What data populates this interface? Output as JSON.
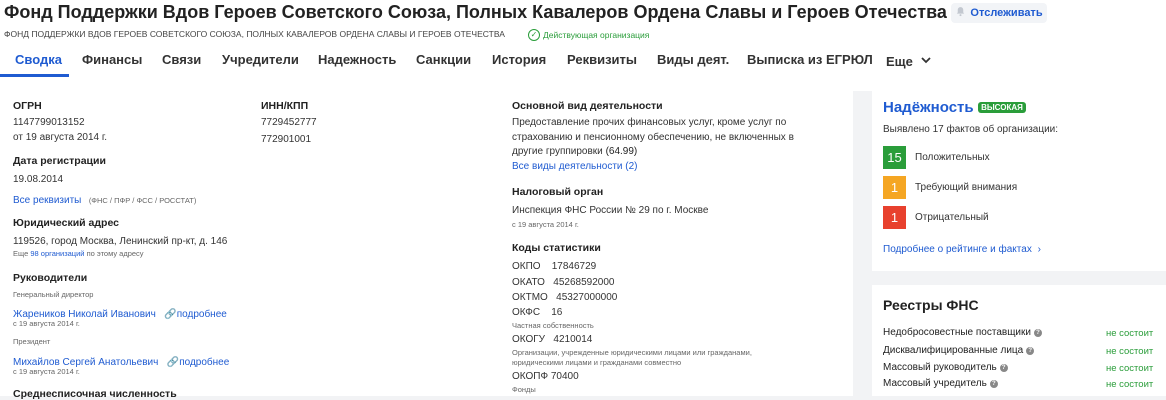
{
  "header": {
    "title": "Фонд Поддержки Вдов Героев Советского Союза, Полных Кавалеров Ордена Славы и Героев Отечества",
    "follow_label": "Отслеживать",
    "subtitle": "ФОНД ПОДДЕРЖКИ ВДОВ ГЕРОЕВ СОВЕТСКОГО СОЮЗА, ПОЛНЫХ КАВАЛЕРОВ ОРДЕНА СЛАВЫ И ГЕРОЕВ ОТЕЧЕСТВА",
    "status": "Действующая организация"
  },
  "tabs": [
    {
      "label": "Сводка"
    },
    {
      "label": "Финансы"
    },
    {
      "label": "Связи"
    },
    {
      "label": "Учредители"
    },
    {
      "label": "Надежность"
    },
    {
      "label": "Санкции"
    },
    {
      "label": "История"
    },
    {
      "label": "Реквизиты"
    },
    {
      "label": "Виды деят."
    },
    {
      "label": "Выписка из ЕГРЮЛ"
    },
    {
      "label": "Еще"
    }
  ],
  "summary": {
    "ogrn": {
      "label": "ОГРН",
      "value": "1147799013152",
      "date": "от 19 августа 2014 г."
    },
    "inn": {
      "label": "ИНН/КПП",
      "inn": "7729452777",
      "kpp": "772901001"
    },
    "reg_date": {
      "label": "Дата регистрации",
      "value": "19.08.2014"
    },
    "all_requisites": {
      "label": "Все реквизиты",
      "note": "(ФНС / ПФР / ФСС / РОССТАТ)"
    },
    "address": {
      "label": "Юридический адрес",
      "value": "119526, город Москва, Ленинский пр-кт, д. 146",
      "note_prefix": "Еще",
      "note_link": "98 организаций",
      "note_suffix": "по этому адресу"
    },
    "managers": {
      "label": "Руководители",
      "items": [
        {
          "role": "Генеральный директор",
          "name": "Жареников Николай Иванович",
          "more": "подробнее",
          "since": "с 19 августа 2014 г."
        },
        {
          "role": "Президент",
          "name": "Михайлов Сергей Анатольевич",
          "more": "подробнее",
          "since": "с 19 августа 2014 г."
        }
      ]
    },
    "cut_text": "Среднесписочная численность",
    "activity": {
      "label": "Основной вид деятельности",
      "lines": [
        "Предоставление прочих финансовых услуг, кроме услуг по",
        "страхованию и пенсионному обеспечению, не включенных в"
      ],
      "last_line": "другие группировки",
      "code": "(64.99)",
      "all_link": "Все виды деятельности (2)"
    },
    "tax": {
      "label": "Налоговый орган",
      "value": "Инспекция ФНС России № 29 по г. Москве",
      "since": "с 19 августа 2014 г."
    },
    "stats": {
      "label": "Коды статистики",
      "codes": [
        {
          "code": "ОКПО",
          "value": "17846729"
        },
        {
          "code": "ОКАТО",
          "value": "45268592000"
        },
        {
          "code": "ОКТМО",
          "value": "45327000000"
        },
        {
          "code": "ОКФС",
          "value": "16",
          "desc": "Частная собственность"
        },
        {
          "code": "ОКОГУ",
          "value": "4210014",
          "desc_lines": [
            "Организации, учрежденные юридическими лицами или гражданами,",
            "юридическими лицами и гражданами совместно"
          ]
        },
        {
          "code": "ОКОПФ",
          "value": "70400",
          "desc": "Фонды"
        }
      ]
    }
  },
  "reliability": {
    "title": "Надёжность",
    "badge": "ВЫСОКАЯ",
    "facts_text": "Выявлено 17 фактов об организации:",
    "items": [
      {
        "count": "15",
        "label": "Положительных",
        "color": "#2a9d3a"
      },
      {
        "count": "1",
        "label": "Требующий внимания",
        "color": "#f5a623"
      },
      {
        "count": "1",
        "label": "Отрицательный",
        "color": "#e8412e"
      }
    ],
    "more_link": "Подробнее о рейтинге и фактах"
  },
  "fns": {
    "title": "Реестры ФНС",
    "rows": [
      {
        "label": "Недобросовестные поставщики",
        "status": "не состоит"
      },
      {
        "label": "Дисквалифицированные лица",
        "status": "не состоит"
      },
      {
        "label": "Массовый руководитель",
        "status": "не состоит"
      },
      {
        "label": "Массовый учредитель",
        "status": "не состоит"
      }
    ]
  }
}
